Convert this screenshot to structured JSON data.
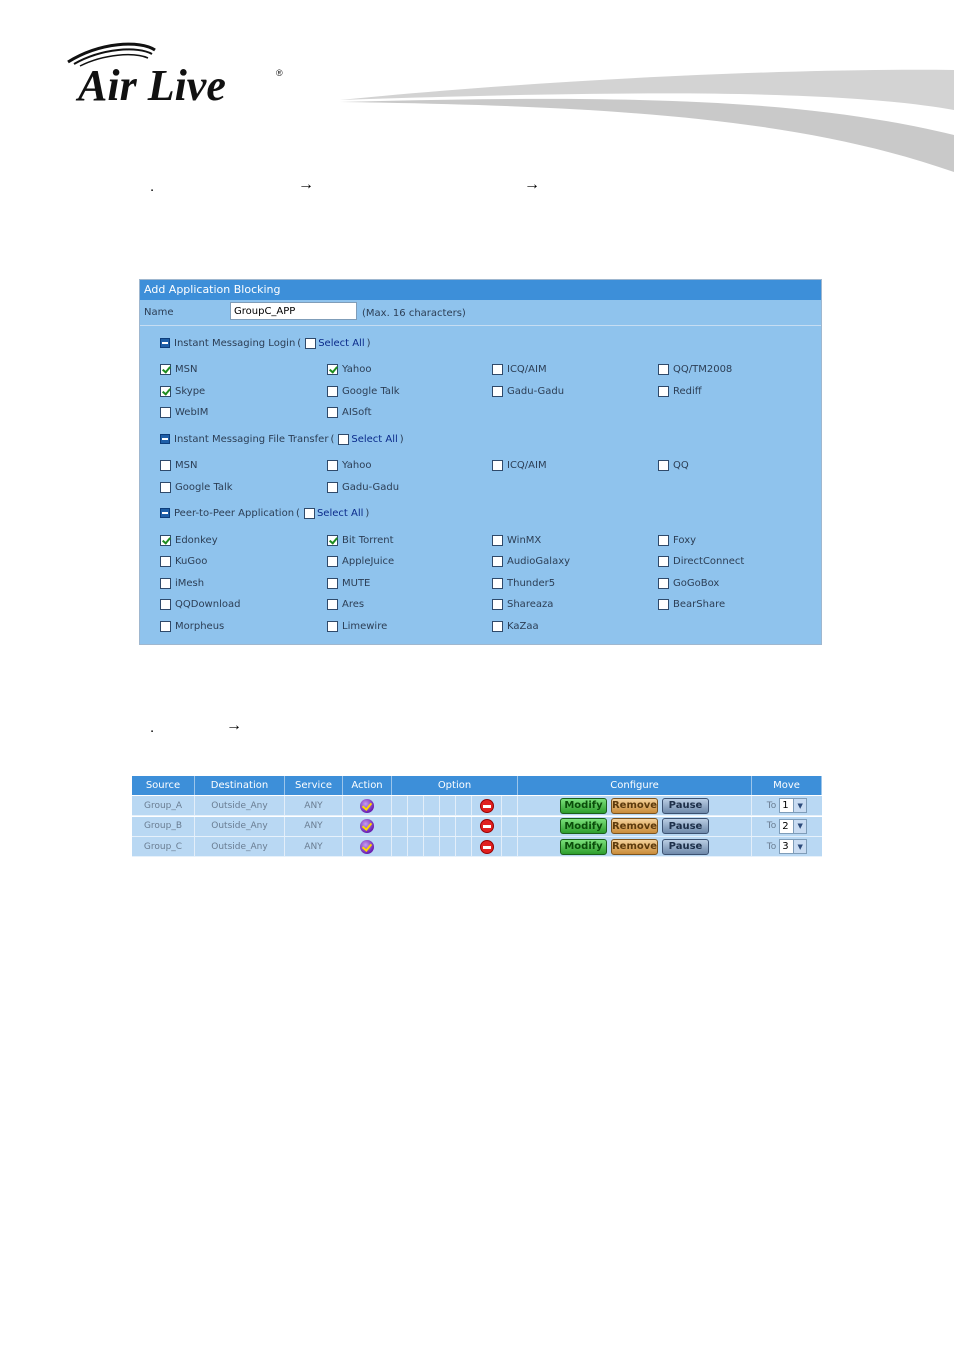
{
  "brand": {
    "logo_text": "Air Live",
    "registered": "®"
  },
  "steps": [
    {
      "bullet": ".",
      "arrows": [
        "→",
        "→"
      ]
    },
    {
      "bullet": ".",
      "arrows": [
        "→"
      ]
    }
  ],
  "app_blocking": {
    "title": "Add Application Blocking",
    "name_label": "Name",
    "name_value": "GroupC_APP",
    "name_hint": "(Max. 16 characters)",
    "sections": [
      {
        "label": "Instant Messaging Login",
        "open_paren": "(",
        "select_all": "Select All",
        "close_paren": ")",
        "items": [
          {
            "label": "MSN",
            "checked": true
          },
          {
            "label": "Yahoo",
            "checked": true
          },
          {
            "label": "ICQ/AIM",
            "checked": false
          },
          {
            "label": "QQ/TM2008",
            "checked": false
          },
          {
            "label": "Skype",
            "checked": true
          },
          {
            "label": "Google Talk",
            "checked": false
          },
          {
            "label": "Gadu-Gadu",
            "checked": false
          },
          {
            "label": "Rediff",
            "checked": false
          },
          {
            "label": "WebIM",
            "checked": false
          },
          {
            "label": "AISoft",
            "checked": false
          }
        ]
      },
      {
        "label": "Instant Messaging File Transfer",
        "open_paren": "(",
        "select_all": "Select All",
        "close_paren": ")",
        "items": [
          {
            "label": "MSN",
            "checked": false
          },
          {
            "label": "Yahoo",
            "checked": false
          },
          {
            "label": "ICQ/AIM",
            "checked": false
          },
          {
            "label": "QQ",
            "checked": false
          },
          {
            "label": "Google Talk",
            "checked": false
          },
          {
            "label": "Gadu-Gadu",
            "checked": false
          }
        ]
      },
      {
        "label": "Peer-to-Peer Application",
        "open_paren": "(",
        "select_all": "Select All",
        "close_paren": ")",
        "items": [
          {
            "label": "Edonkey",
            "checked": true
          },
          {
            "label": "Bit Torrent",
            "checked": true
          },
          {
            "label": "WinMX",
            "checked": false
          },
          {
            "label": "Foxy",
            "checked": false
          },
          {
            "label": "KuGoo",
            "checked": false
          },
          {
            "label": "AppleJuice",
            "checked": false
          },
          {
            "label": "AudioGalaxy",
            "checked": false
          },
          {
            "label": "DirectConnect",
            "checked": false
          },
          {
            "label": "iMesh",
            "checked": false
          },
          {
            "label": "MUTE",
            "checked": false
          },
          {
            "label": "Thunder5",
            "checked": false
          },
          {
            "label": "GoGoBox",
            "checked": false
          },
          {
            "label": "QQDownload",
            "checked": false
          },
          {
            "label": "Ares",
            "checked": false
          },
          {
            "label": "Shareaza",
            "checked": false
          },
          {
            "label": "BearShare",
            "checked": false
          },
          {
            "label": "Morpheus",
            "checked": false
          },
          {
            "label": "Limewire",
            "checked": false
          },
          {
            "label": "KaZaa",
            "checked": false
          }
        ]
      }
    ]
  },
  "policy_table": {
    "headers": [
      "Source",
      "Destination",
      "Service",
      "Action",
      "Option",
      "Configure",
      "Move"
    ],
    "rows": [
      {
        "source": "Group_A",
        "destination": "Outside_Any",
        "service": "ANY",
        "action_icon": "permit-icon",
        "option_icon": "block-icon",
        "move_to": "To",
        "move_value": "1"
      },
      {
        "source": "Group_B",
        "destination": "Outside_Any",
        "service": "ANY",
        "action_icon": "permit-icon",
        "option_icon": "block-icon",
        "move_to": "To",
        "move_value": "2"
      },
      {
        "source": "Group_C",
        "destination": "Outside_Any",
        "service": "ANY",
        "action_icon": "permit-icon",
        "option_icon": "block-icon",
        "move_to": "To",
        "move_value": "3"
      }
    ],
    "buttons": {
      "modify": "Modify",
      "remove": "Remove",
      "pause": "Pause"
    }
  },
  "colors": {
    "header_blue": "#3d8fd9",
    "panel_blue": "#8fc3ed",
    "row_blue": "#b9d8f3"
  }
}
